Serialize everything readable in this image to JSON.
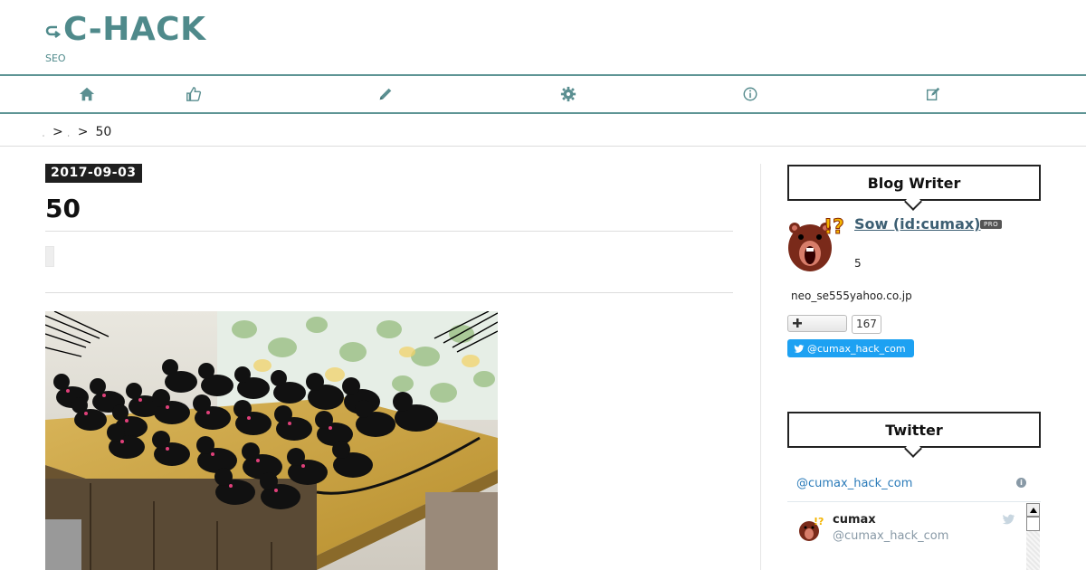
{
  "site": {
    "logo_icon": "arrow-loop-icon",
    "logo_text": "C-HACK",
    "subtitle": "SEO",
    "theme_color": "#4f8a8b"
  },
  "nav": {
    "items": [
      {
        "name": "home-icon"
      },
      {
        "name": "thumbs-up-icon"
      },
      {
        "name": "pencil-icon"
      },
      {
        "name": "gear-icon"
      },
      {
        "name": "info-icon"
      },
      {
        "name": "edit-icon"
      }
    ]
  },
  "breadcrumb": {
    "link1": "̣",
    "link2": "̣",
    "sep": ">",
    "current": "50"
  },
  "post": {
    "date": "2017-09-03",
    "title": "50"
  },
  "sidebar": {
    "writer_heading": "Blog Writer",
    "writer_name": "Sow (id:cumax)",
    "pro_label": "PRO",
    "writer_count": "5",
    "writer_email": "neo_se555yahoo.co.jp",
    "follow_count": "167",
    "twitter_button": "@cumax_hack_com",
    "twitter_heading": "Twitter",
    "twitter_handle": "@cumax_hack_com",
    "tweet_name": "cumax",
    "tweet_user": "@cumax_hack_com",
    "twitter_color": "#1da1f2"
  }
}
